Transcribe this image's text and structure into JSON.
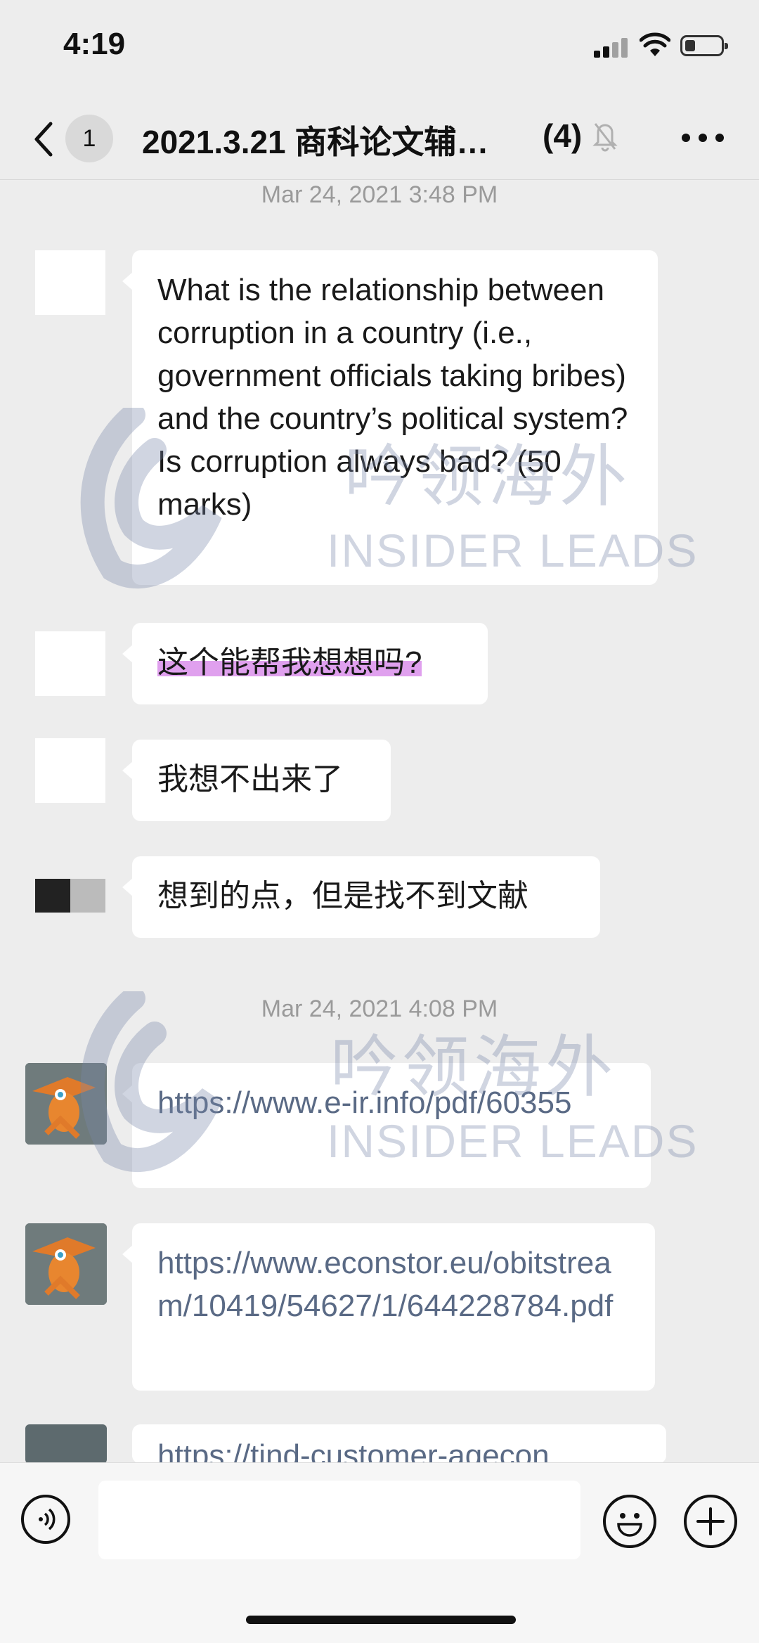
{
  "status_bar": {
    "time": "4:19"
  },
  "header": {
    "unread_count": "1",
    "title": "2021.3.21 商科论文辅…",
    "member_count": "(4)"
  },
  "messages": [
    {
      "timestamp": "Mar 24, 2021 3:48 PM"
    },
    {
      "text": "What is the relationship between corruption in a country (i.e., government officials taking bribes) and the country’s political system? Is corruption always bad? (50 marks)"
    },
    {
      "text": "这个能帮我想想吗?"
    },
    {
      "text": "我想不出来了"
    },
    {
      "text": "想到的点，但是找不到文献"
    },
    {
      "timestamp": "Mar 24, 2021 4:08 PM"
    },
    {
      "text": "https://www.e-ir.info/pdf/60355"
    },
    {
      "text": "https://www.econstor.eu/obitstream/10419/54627/1/644228784.pdf"
    },
    {
      "text": "https://tind-customer-agecon"
    }
  ],
  "watermark": {
    "cn": "吟领海外",
    "en": "INSIDER LEADS"
  },
  "colors": {
    "background": "#ededed",
    "bubble": "#ffffff",
    "link": "#5a6a85",
    "highlight": "#d278e6"
  }
}
